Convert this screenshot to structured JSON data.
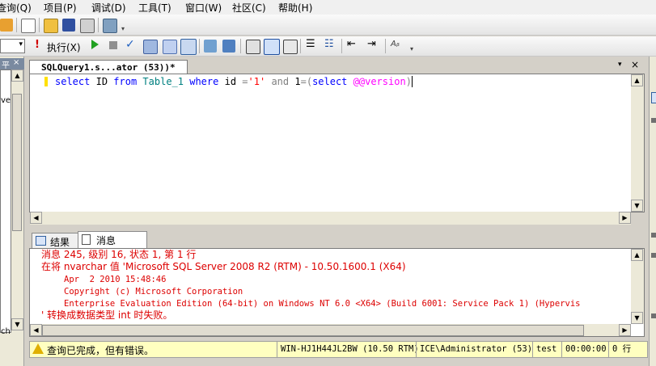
{
  "menubar": {
    "items": [
      "查询(Q)",
      "项目(P)",
      "调试(D)",
      "工具(T)",
      "窗口(W)",
      "社区(C)",
      "帮助(H)"
    ]
  },
  "toolbar2": {
    "execute_label": "执行(X)"
  },
  "left_panel": {
    "fragment_top": "ve",
    "fragment_bottom": "ch",
    "pin_glyph": "平"
  },
  "editor": {
    "tab_title": "SQLQuery1.s...ator (53))*",
    "query": {
      "t1": "select",
      "t2": "ID",
      "t3": "from",
      "t4": "Table_1",
      "t5": "where",
      "t6": "id",
      "t7": "=",
      "t8": "'1'",
      "t9": "and",
      "t10": "1",
      "t11": "=",
      "t12": "(",
      "t13": "select",
      "t14": "@@version",
      "t15": ")"
    }
  },
  "results": {
    "tab_results": "结果",
    "tab_messages": "消息",
    "lines": [
      "消息 245, 级别 16, 状态 1, 第 1 行",
      "在将 nvarchar 值 'Microsoft SQL Server 2008 R2 (RTM) - 10.50.1600.1 (X64)",
      "Apr  2 2010 15:48:46",
      "Copyright (c) Microsoft Corporation",
      "Enterprise Evaluation Edition (64-bit) on Windows NT 6.0 <X64> (Build 6001: Service Pack 1) (Hypervis",
      "' 转换成数据类型 int 时失败。"
    ]
  },
  "statusbar": {
    "message": "查询已完成，但有错误。",
    "server": "WIN-HJ1H44JL2BW (10.50 RTM)",
    "user": "ICE\\Administrator (53)",
    "database": "test",
    "elapsed": "00:00:00",
    "rows": "0 行"
  },
  "colors": {
    "error_text": "#dd0000",
    "keyword": "#0000ff",
    "identifier": "#008080",
    "string": "#ff0000",
    "status_bg": "#ffffc0"
  }
}
